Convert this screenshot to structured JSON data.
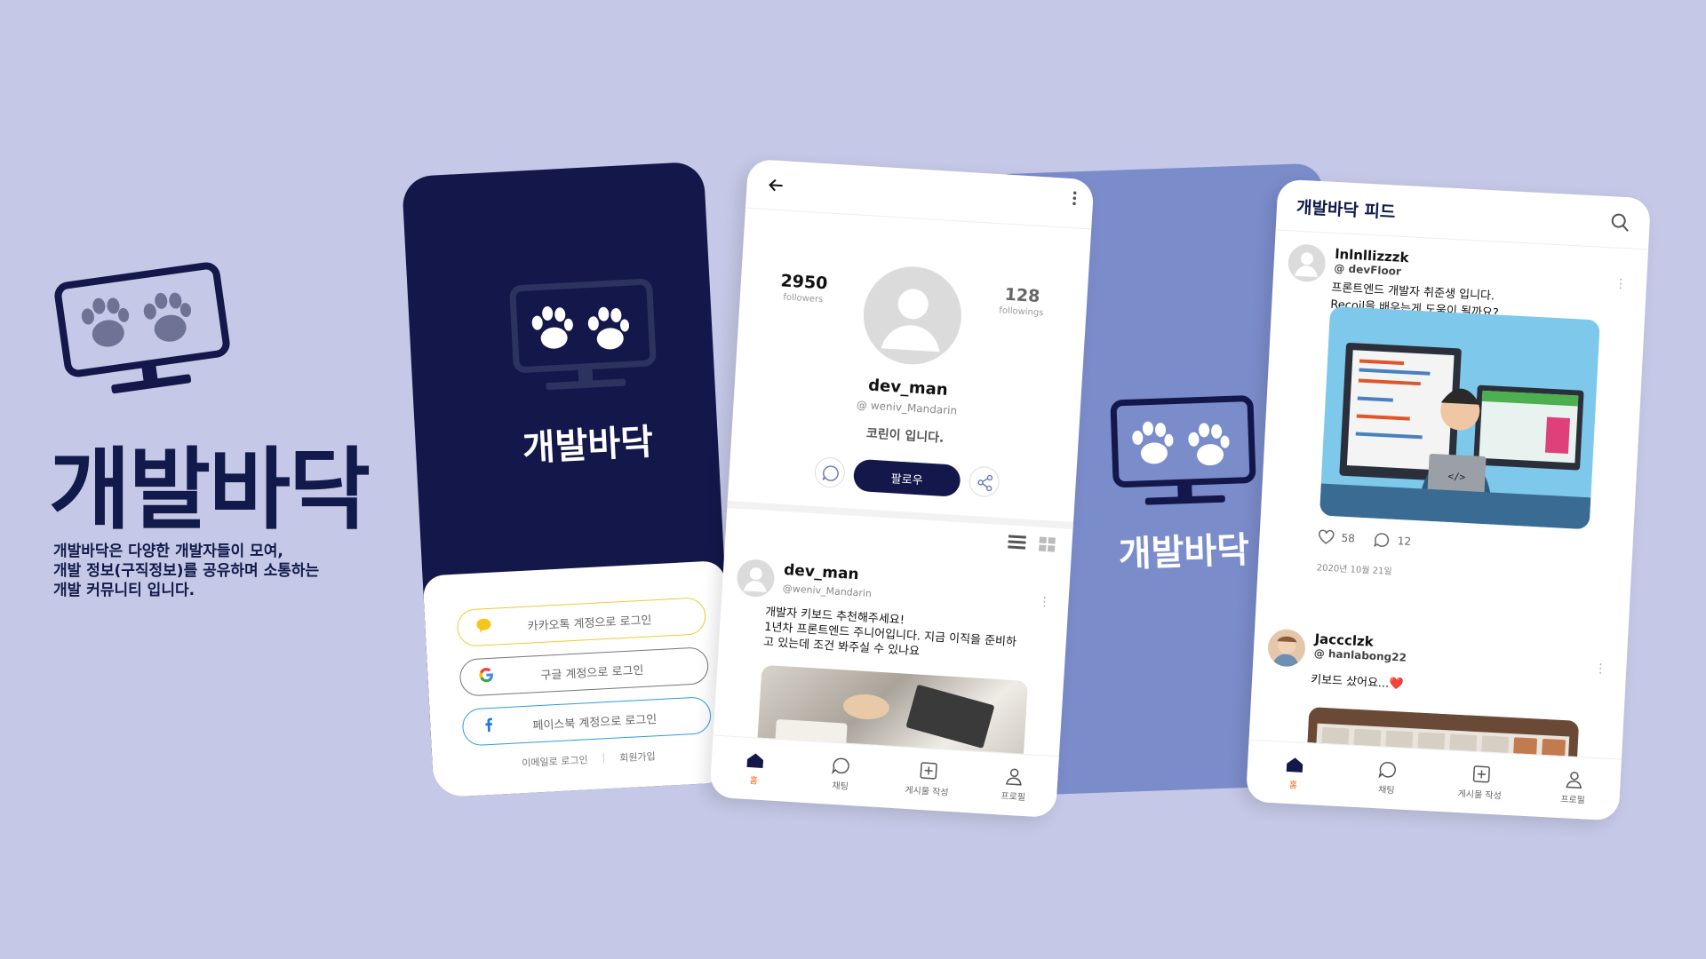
{
  "brand": {
    "title": "개발바닥",
    "description_lines": [
      "개발바닥은 다양한 개발자들이 모여,",
      "개발 정보(구직정보)를 공유하며 소통하는",
      "개발 커뮤니티 입니다."
    ]
  },
  "login_screen": {
    "logo_text": "개발바닥",
    "buttons": {
      "kakao": "카카오톡 계정으로 로그인",
      "google": "구글 계정으로 로그인",
      "facebook": "페이스북 계정으로 로그인"
    },
    "links": {
      "email": "이메일로 로그인",
      "signup": "회원가입",
      "separator": "|"
    }
  },
  "profile_screen": {
    "followers": {
      "count": "2950",
      "label": "followers"
    },
    "followings": {
      "count": "128",
      "label": "followings"
    },
    "name": "dev_man",
    "handle": "@ weniv_Mandarin",
    "intro": "코린이 입니다.",
    "follow_button": "팔로우",
    "post": {
      "author": "dev_man",
      "handle": "@weniv_Mandarin",
      "text_lines": [
        "개발자 키보드 추천해주세요!",
        "1년차 프론트엔드 주니어입니다. 지금 이직을 준비하",
        "고 있는데 조건 봐주실 수 있나요"
      ]
    },
    "tabs": {
      "home": "홈",
      "chat": "채팅",
      "write": "게시물 작성",
      "profile": "프로필"
    }
  },
  "splash_screen": {
    "logo_text": "개발바닥"
  },
  "feed_screen": {
    "title": "개발바닥 피드",
    "posts": [
      {
        "author": "lnlnllizzzk",
        "handle": "@ devFloor",
        "text_lines": [
          "프론트엔드 개발자 취준생 입니다.",
          "Recoil을 배우는게 도움이 될까요?"
        ],
        "likes": "58",
        "comments": "12",
        "date": "2020년 10월 21일"
      },
      {
        "author": "Jaccclzk",
        "handle": "@ hanlabong22",
        "text": "키보드 샀어요...❤️"
      }
    ],
    "tabs": {
      "home": "홈",
      "chat": "채팅",
      "write": "게시물 작성",
      "profile": "프로필"
    }
  },
  "colors": {
    "background": "#c5c8e6",
    "navy": "#13174a",
    "splash_blue": "#7b8ccb",
    "active_tab": "#f26e22"
  }
}
